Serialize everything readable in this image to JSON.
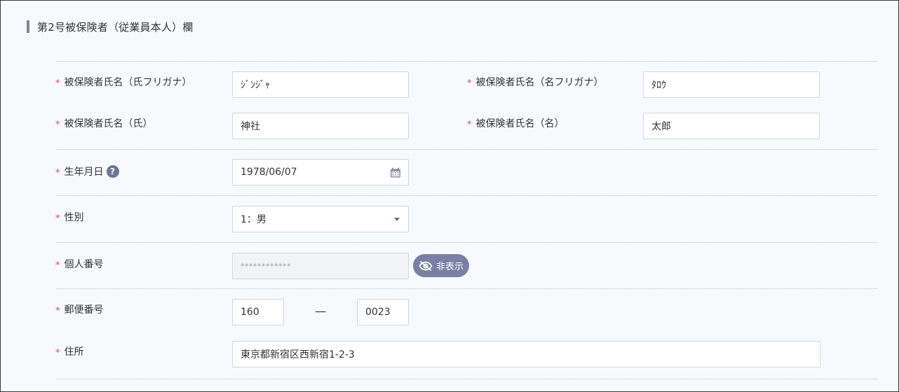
{
  "section": {
    "title": "第2号被保険者（従業員本人）欄"
  },
  "required_mark": "*",
  "fields": {
    "kana_last": {
      "label": "被保険者氏名（氏フリガナ）",
      "value": "ｼﾞﾝｼﾞｬ"
    },
    "kana_first": {
      "label": "被保険者氏名（名フリガナ）",
      "value": "ﾀﾛｳ"
    },
    "name_last": {
      "label": "被保険者氏名（氏）",
      "value": "神社"
    },
    "name_first": {
      "label": "被保険者氏名（名）",
      "value": "太郎"
    },
    "birthdate": {
      "label": "生年月日",
      "value": "1978/06/07",
      "help": "?"
    },
    "gender": {
      "label": "性別",
      "value": "1：男"
    },
    "my_number": {
      "label": "個人番号",
      "value": "************",
      "toggle_label": "非表示"
    },
    "postal": {
      "label": "郵便番号",
      "part1": "160",
      "separator": "—",
      "part2": "0023"
    },
    "address": {
      "label": "住所",
      "value": "東京都新宿区西新宿1-2-3"
    }
  },
  "colors": {
    "required": "#e34a4a",
    "accent": "#7a80a3",
    "title_bar": "#7f849e"
  },
  "icons": {
    "help": "question-circle-icon",
    "calendar": "calendar-icon",
    "dropdown": "caret-down-icon",
    "hide": "eye-slash-icon"
  }
}
